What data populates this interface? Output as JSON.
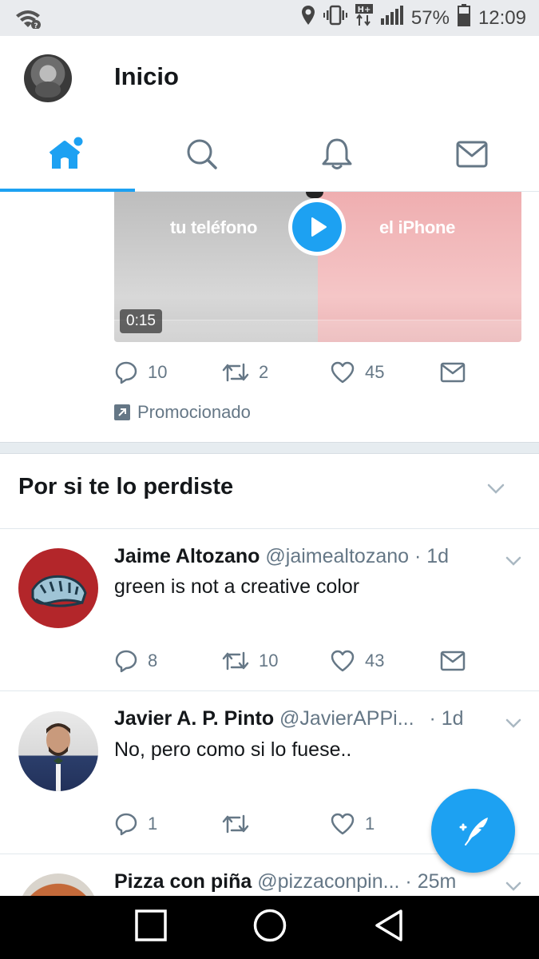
{
  "status_bar": {
    "battery": "57%",
    "time": "12:09",
    "network_label": "H+"
  },
  "header": {
    "title": "Inicio",
    "tabs": [
      {
        "name": "home",
        "icon": "home-icon",
        "active": true
      },
      {
        "name": "search",
        "icon": "search-icon",
        "active": false
      },
      {
        "name": "notifications",
        "icon": "bell-icon",
        "active": false
      },
      {
        "name": "messages",
        "icon": "mail-icon",
        "active": false
      }
    ]
  },
  "promoted_tweet": {
    "media_left_text": "tu teléfono",
    "media_right_text": "el iPhone",
    "duration": "0:15",
    "replies": "10",
    "retweets": "2",
    "likes": "45",
    "promoted_label": "Promocionado"
  },
  "section": {
    "title": "Por si te lo perdiste"
  },
  "tweets": [
    {
      "name": "Jaime Altozano",
      "handle": "@jaimealtozano",
      "time": "· 1d",
      "text": "green is not a creative color",
      "replies": "8",
      "retweets": "10",
      "likes": "43"
    },
    {
      "name": "Javier A. P. Pinto",
      "handle": "@JavierAPPi...",
      "time": "· 1d",
      "text": "No, pero como si lo fuese..",
      "replies": "1",
      "retweets": "",
      "likes": "1"
    },
    {
      "name": "Pizza con piña",
      "handle": "@pizzaconpin...",
      "time": "· 25m"
    }
  ],
  "colors": {
    "accent": "#1da1f2",
    "secondary_text": "#657786",
    "primary_text": "#14171a"
  }
}
